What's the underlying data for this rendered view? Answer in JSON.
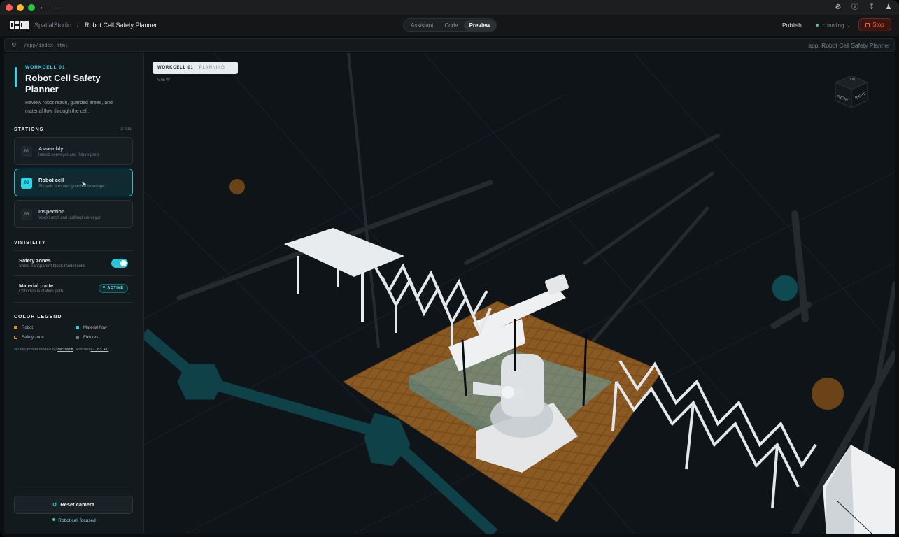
{
  "window": {
    "traffic_lights": [
      "#ff5f57",
      "#febc2e",
      "#28c840"
    ],
    "icons": [
      "back-icon",
      "forward-icon",
      "settings-icon",
      "help-icon",
      "download-icon",
      "user-icon"
    ]
  },
  "header": {
    "brand": "SpatialStudio",
    "separator": "/",
    "project": "Robot Cell Safety Planner",
    "tabs": [
      {
        "label": "Assistant",
        "active": false
      },
      {
        "label": "Code",
        "active": false
      },
      {
        "label": "Preview",
        "active": true
      }
    ],
    "publish": "Publish",
    "status": "running",
    "stop": "Stop"
  },
  "urlbar": {
    "path": "/app/index.html",
    "app_title": "app: Robot Cell Safety Planner"
  },
  "sidebar": {
    "eyebrow": "WORKCELL 01",
    "title": "Robot Cell Safety Planner",
    "description": "Review robot reach, guarded areas, and material flow through the cell.",
    "stations_heading": "STATIONS",
    "stations_total": "3 total",
    "stations": [
      {
        "num": "01",
        "name": "Assembly",
        "sub": "Infeed conveyor and fixture prep",
        "selected": false
      },
      {
        "num": "02",
        "name": "Robot cell",
        "sub": "Six-axis arm and guarded envelope",
        "selected": true
      },
      {
        "num": "03",
        "name": "Inspection",
        "sub": "Vision arch and outfeed conveyor",
        "selected": false
      }
    ],
    "visibility_heading": "VISIBILITY",
    "visibility": [
      {
        "name": "Safety zones",
        "sub": "Show transparent block-model cells",
        "control": "toggle",
        "on": true
      },
      {
        "name": "Material route",
        "sub": "Continuous station path",
        "control": "badge",
        "badge": "ACTIVE"
      }
    ],
    "legend_heading": "COLOR LEGEND",
    "legend": [
      {
        "label": "Robot",
        "color": "#e0902b",
        "style": "fill"
      },
      {
        "label": "Material flow",
        "color": "#2bd6e6",
        "style": "fill"
      },
      {
        "label": "Safety zone",
        "color": "#e0a12b",
        "style": "outline"
      },
      {
        "label": "Fixtures",
        "color": "#6b757b",
        "style": "fill"
      }
    ],
    "credit_prefix": "3D equipment models by",
    "credit_author": "Microsoft",
    "credit_mid": ", licensed",
    "credit_license": "CC BY 4.0",
    "reset_label": "Reset camera",
    "focus_status": "Robot cell focused"
  },
  "viewport": {
    "chip_title": "WORKCELL 01",
    "chip_sub": "PLANNING VIEW",
    "viewcube_faces": [
      "TOP",
      "FRONT",
      "RIGHT"
    ],
    "accent": "#2bd6e6",
    "floor_color": "#8a5a22"
  }
}
